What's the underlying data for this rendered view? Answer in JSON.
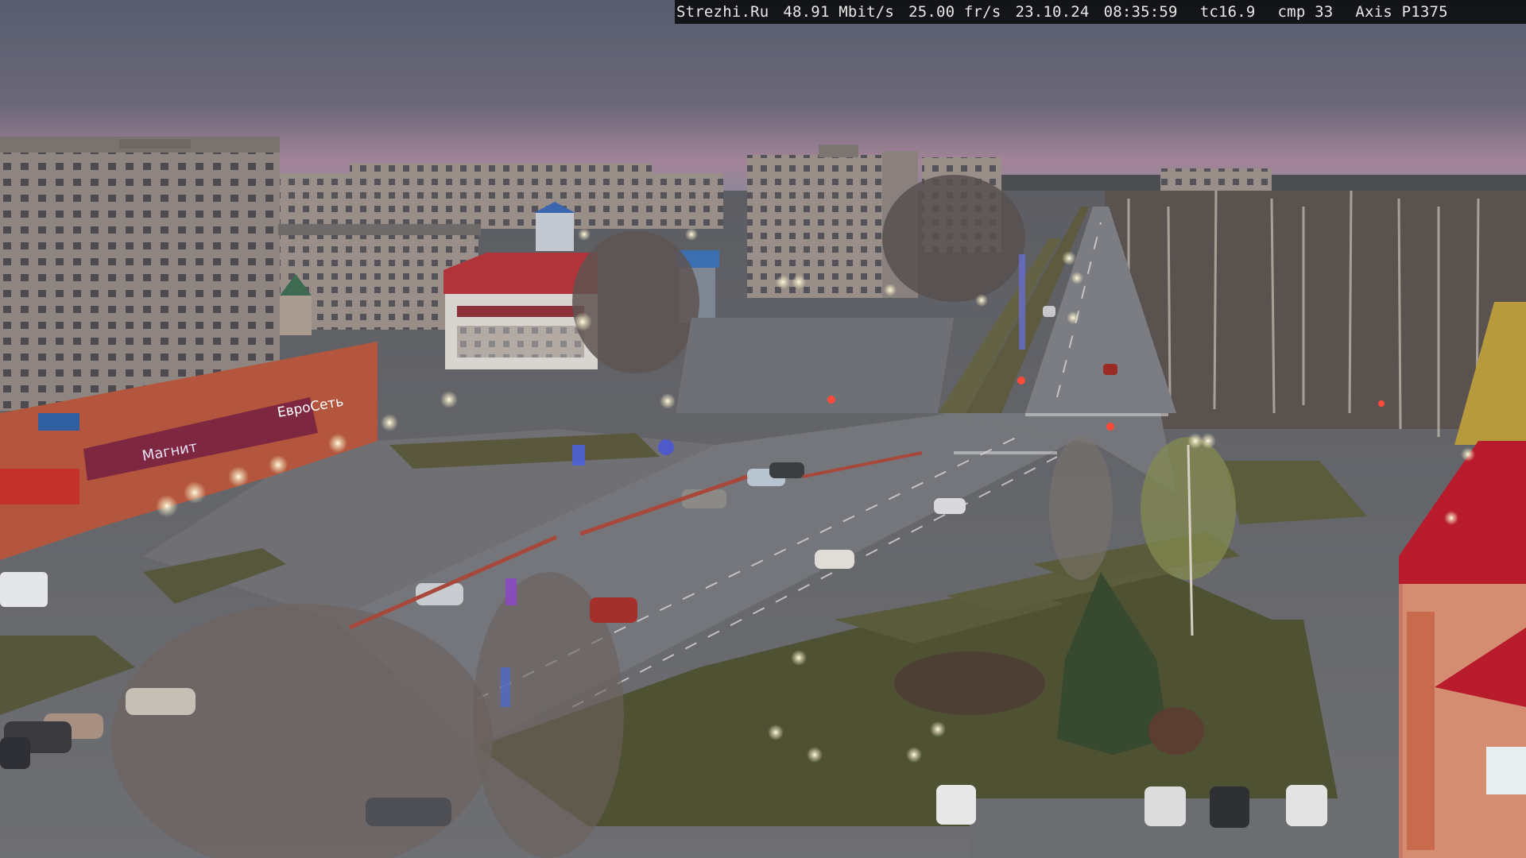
{
  "osd": {
    "site": "Strezhi.Ru",
    "bitrate": "48.91 Mbit/s",
    "framerate": "25.00 fr/s",
    "date": "23.10.24",
    "time": "08:35:59",
    "tc": "tc16.9",
    "cmp": "cmp 33",
    "camera": "Axis P1375"
  },
  "storefront": {
    "sign_1": "ЕвроСеть",
    "sign_2": "Магнит"
  },
  "colors": {
    "sky_top": "#5b6272",
    "sky_horizon": "#b18a9c",
    "asphalt": "#6b6d72",
    "grass": "#5a5a3a",
    "brick": "#b4563d",
    "roof_red": "#b81c2c"
  }
}
